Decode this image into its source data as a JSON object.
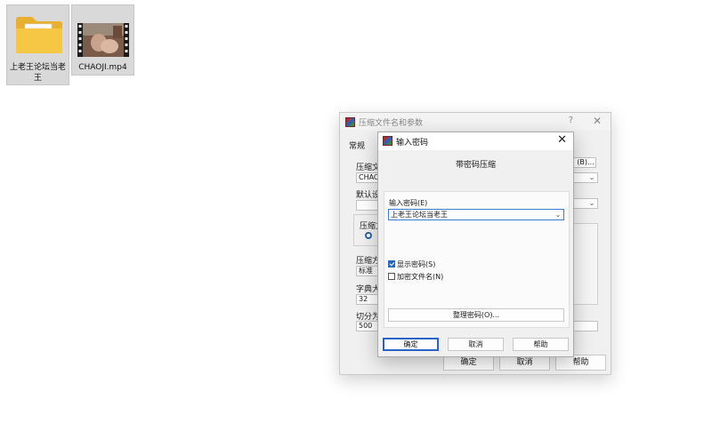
{
  "desktop": {
    "folder": {
      "label": "上老王论坛当老王"
    },
    "video": {
      "label": "CHAOJI.mp4"
    }
  },
  "archive_dialog": {
    "title": "压缩文件名和参数",
    "help_glyph": "?",
    "close_glyph": "✕",
    "tab_general": "常规",
    "labels": {
      "archive_name": "压缩文",
      "default_profile": "默认设",
      "archive_format": "压缩文",
      "compression_method": "压缩方",
      "dictionary_size": "字典大",
      "split_volumes": "切分为"
    },
    "fields": {
      "archive_name_value": "CHAO",
      "compression_method_value": "标准",
      "dictionary_size_value": "32",
      "split_volumes_value": "500",
      "browse_button": "(B)..."
    },
    "buttons": {
      "ok": "确定",
      "cancel": "取消",
      "help": "帮助"
    }
  },
  "password_dialog": {
    "title": "输入密码",
    "close_glyph": "✕",
    "heading": "带密码压缩",
    "password_label": "输入密码(E)",
    "password_value": "上老王论坛当老王",
    "show_password": {
      "label": "显示密码(S)",
      "checked": true
    },
    "encrypt_filenames": {
      "label": "加密文件名(N)",
      "checked": false
    },
    "organize_button": "整理密码(O)...",
    "buttons": {
      "ok": "确定",
      "cancel": "取消",
      "help": "帮助"
    }
  },
  "colors": {
    "accent": "#2a63c6",
    "folder": "#f3c13a",
    "selection": "#d9d9d9"
  }
}
